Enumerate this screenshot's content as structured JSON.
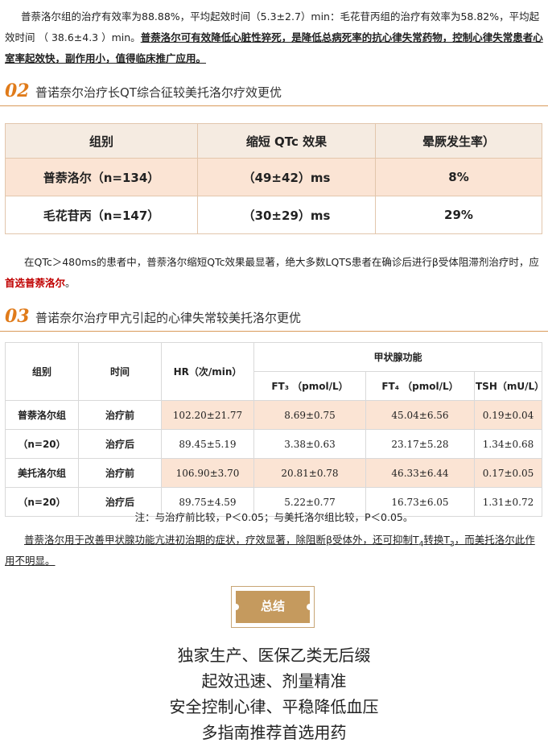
{
  "intro": {
    "text_a": "普萘洛尔组的治疗有效率为88.88%，平均起效时间（5.3±2.7）min：毛花苷丙组的治疗有效率为58.82%，平均起效时间 （ 38.6±4.3 ）min。",
    "text_b_bold": "普萘洛尔可有效降低心脏性猝死，是降低总病死率的抗心律失常药物，控制心律失常患者心室率起效快，副作用小，值得临床推广应用。"
  },
  "section2": {
    "num": "02",
    "title": "普诺奈尔治疗长QT综合征较美托洛尔疗效更优"
  },
  "table1": {
    "headers": [
      "组别",
      "缩短 QTc 效果",
      "晕厥发生率）"
    ],
    "rows": [
      [
        "普萘洛尔（n=134）",
        "（49±42）ms",
        "8%"
      ],
      [
        "毛花苷丙（n=147）",
        "（30±29）ms",
        "29%"
      ]
    ]
  },
  "para2": {
    "text": "在QTc＞480ms的患者中，普萘洛尔缩短QTc效果最显著，绝大多数LQTS患者在确诊后进行β受体阻滞剂治疗时，应",
    "highlight": "首选普萘洛尔",
    "end": "。"
  },
  "section3": {
    "num": "03",
    "title": "普诺奈尔治疗甲亢引起的心律失常较美托洛尔更优"
  },
  "table2": {
    "h_group": "组别",
    "h_time": "时间",
    "h_hr": "HR（次/min）",
    "h_thyroid": "甲状腺功能",
    "h_ft3": "FT₃ （pmol/L）",
    "h_ft4": "FT₄ （pmol/L）",
    "h_tsh": "TSH（mU/L）",
    "groups": [
      {
        "name": "普萘洛尔组",
        "n": "（n=20）",
        "rows": [
          [
            "治疗前",
            "102.20±21.77",
            "8.69±0.75",
            "45.04±6.56",
            "0.19±0.04"
          ],
          [
            "治疗后",
            "89.45±5.19",
            "3.38±0.63",
            "23.17±5.28",
            "1.34±0.68"
          ]
        ]
      },
      {
        "name": "美托洛尔组",
        "n": "（n=20）",
        "rows": [
          [
            "治疗前",
            "106.90±3.70",
            "20.81±0.78",
            "46.33±6.44",
            "0.17±0.05"
          ],
          [
            "治疗后",
            "89.75±4.59",
            "5.22±0.77",
            "16.73±6.05",
            "1.31±0.72"
          ]
        ]
      }
    ]
  },
  "note": "注：与治疗前比较，P＜0.05；与美托洛尔组比较，P＜0.05。",
  "para3": {
    "text1": "普萘洛尔用于改善甲状腺功能亢进初治期的症状，疗效显著，除阻断β受体外，还可抑制T",
    "sub1": "4",
    "text2": "转换T",
    "sub2": "3",
    "text3": "，而美托洛尔此作用不明显。"
  },
  "summary": {
    "label": "总结"
  },
  "conclusions": [
    "独家生产、医保乙类无后缀",
    "起效迅速、剂量精准",
    "安全控制心律、平稳降低血压",
    "多指南推荐首选用药"
  ],
  "colors": {
    "accent": "#e07b1a",
    "highlight_red": "#c00000",
    "shade": "#fbe4d4",
    "gold": "#c59a5e"
  }
}
